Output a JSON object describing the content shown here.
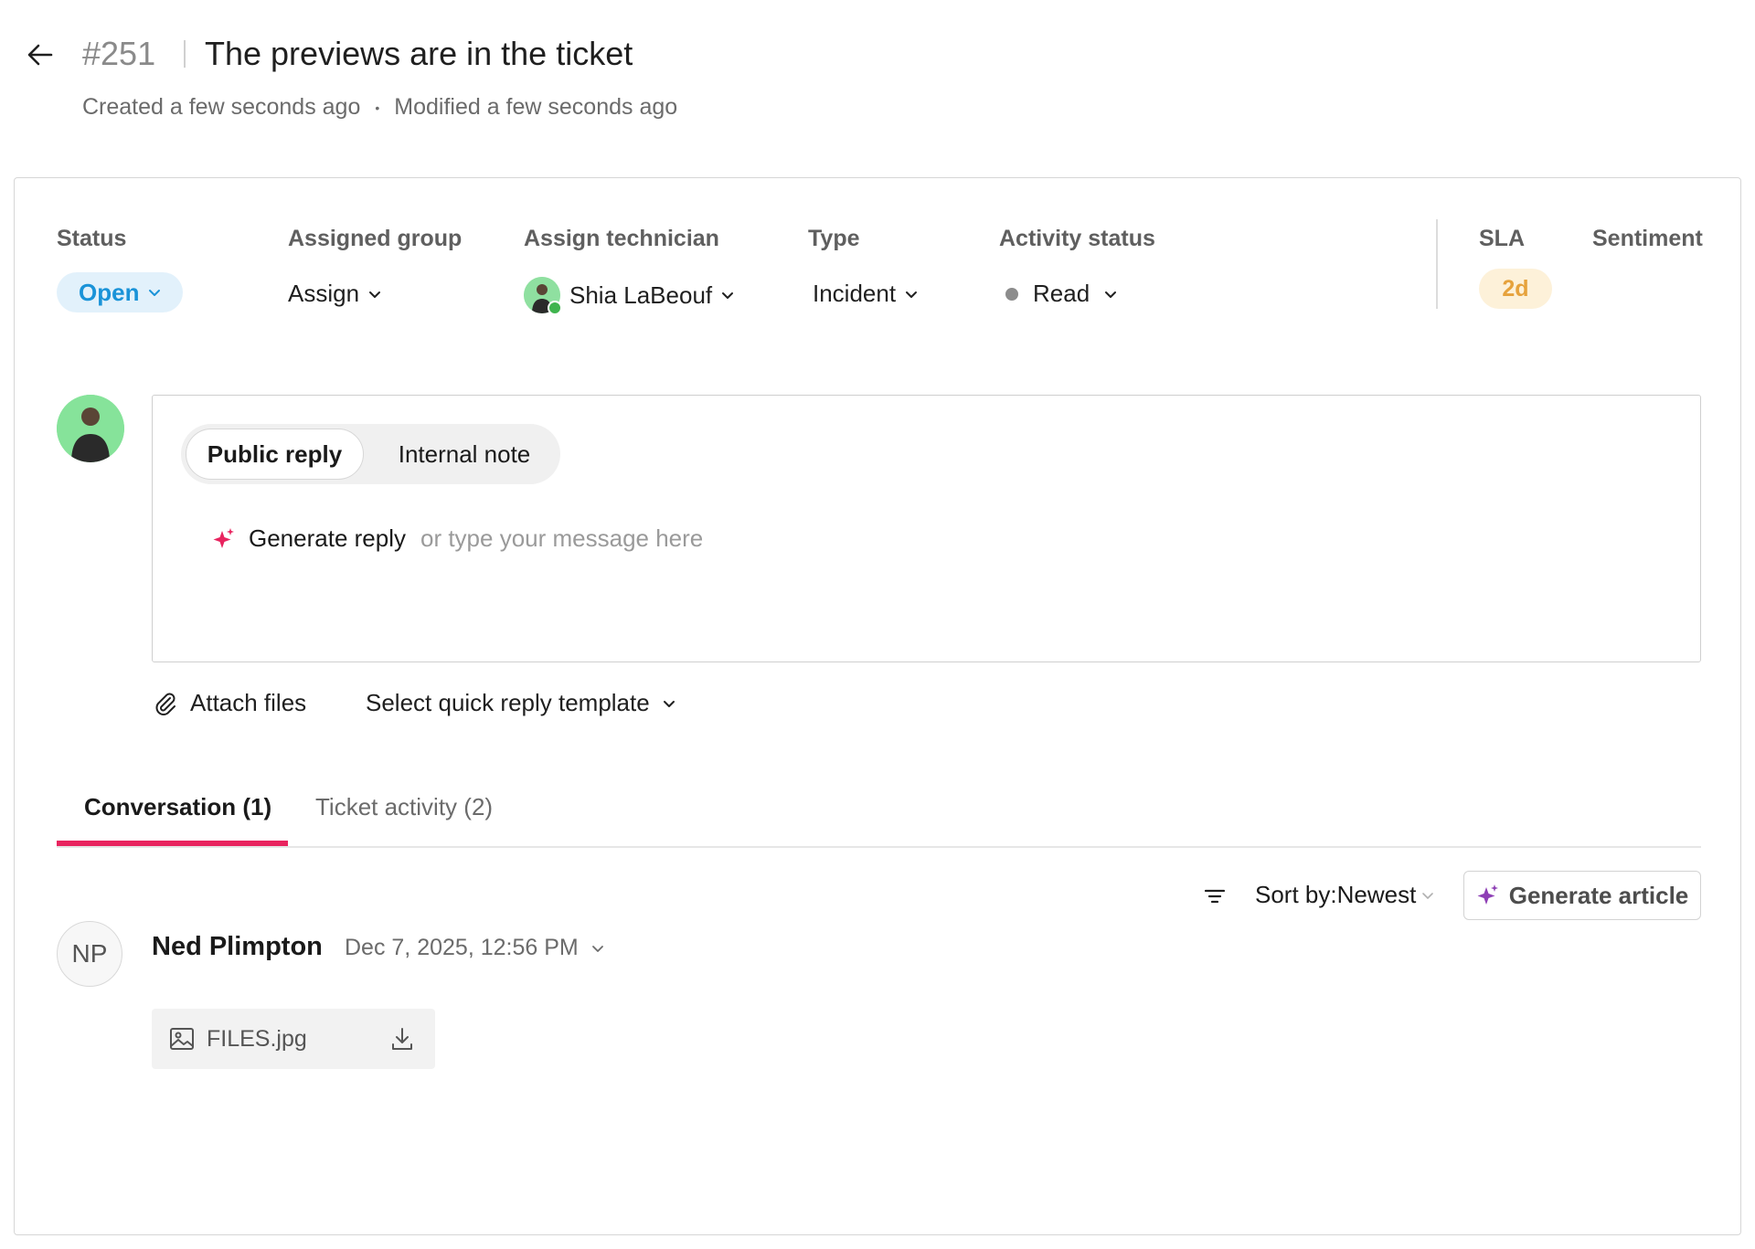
{
  "header": {
    "ticket_id": "#251",
    "title": "The previews are in the ticket",
    "created": "Created a few seconds ago",
    "separator": "•",
    "modified": "Modified a few seconds ago"
  },
  "fields": {
    "status": {
      "label": "Status",
      "value": "Open"
    },
    "assigned_group": {
      "label": "Assigned group",
      "value": "Assign"
    },
    "technician": {
      "label": "Assign technician",
      "value": "Shia LaBeouf"
    },
    "type": {
      "label": "Type",
      "value": "Incident"
    },
    "activity_status": {
      "label": "Activity status",
      "value": "Read"
    },
    "sla": {
      "label": "SLA",
      "value": "2d"
    },
    "sentiment": {
      "label": "Sentiment"
    }
  },
  "composer": {
    "tabs": [
      "Public reply",
      "Internal note"
    ],
    "generate_reply": "Generate reply",
    "placeholder": "or type your message here",
    "attach_files": "Attach files",
    "quick_reply": "Select quick reply template"
  },
  "tabs": {
    "conversation": "Conversation (1)",
    "activity": "Ticket activity (2)"
  },
  "toolbar": {
    "sort_label": "Sort by:Newest",
    "generate_article": "Generate article"
  },
  "message": {
    "initials": "NP",
    "author": "Ned Plimpton",
    "timestamp": "Dec 7, 2025, 12:56 PM",
    "attachment": "FILES.jpg"
  },
  "colors": {
    "accent_pink": "#e8245f",
    "status_blue": "#1a93d8",
    "sla_orange": "#e6a23c",
    "online_green": "#3fb44e"
  }
}
